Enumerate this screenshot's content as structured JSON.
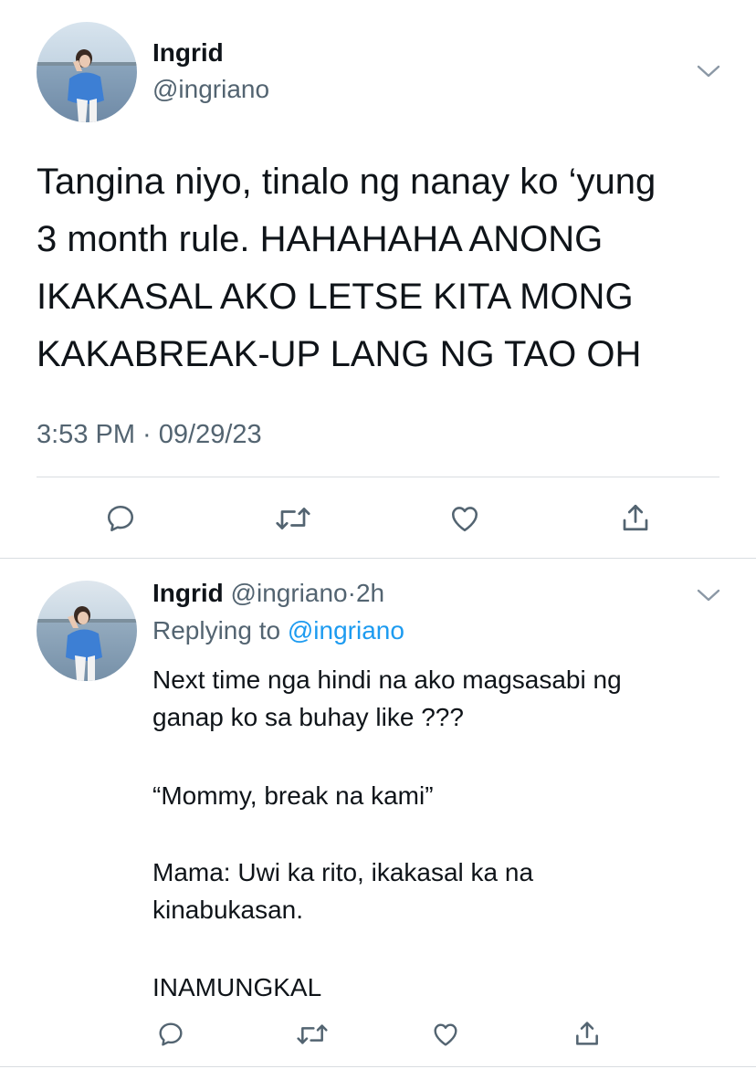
{
  "tweet": {
    "author_name": "Ingrid",
    "author_handle": "@ingriano",
    "text_lines": [
      "Tangina niyo, tinalo ng nanay ko ‘yung",
      "3 month rule. HAHAHAHA ANONG",
      "IKAKASAL AKO LETSE KITA MONG",
      "KAKABREAK-UP LANG NG TAO OH"
    ],
    "timestamp": "3:53 PM · 09/29/23",
    "actions": [
      "reply-icon",
      "retweet-icon",
      "like-icon",
      "share-icon"
    ]
  },
  "reply": {
    "author_name": "Ingrid",
    "author_handle": "@ingriano",
    "separator": "·",
    "time_ago": "2h",
    "replying_prefix": "Replying to",
    "replying_to": "@ingriano",
    "text_lines": [
      "Next time nga hindi na ako magsasabi ng",
      "ganap ko sa buhay like ???",
      "“Mommy, break na kami”",
      "Mama: Uwi ka rito, ikakasal ka na",
      "kinabukasan.",
      "INAMUNGKAL"
    ],
    "actions": [
      "reply-icon",
      "retweet-icon",
      "like-icon",
      "share-icon"
    ]
  },
  "colors": {
    "text": "#0f1419",
    "secondary": "#536471",
    "link": "#1d9bf0",
    "divider": "#d9dde1"
  }
}
